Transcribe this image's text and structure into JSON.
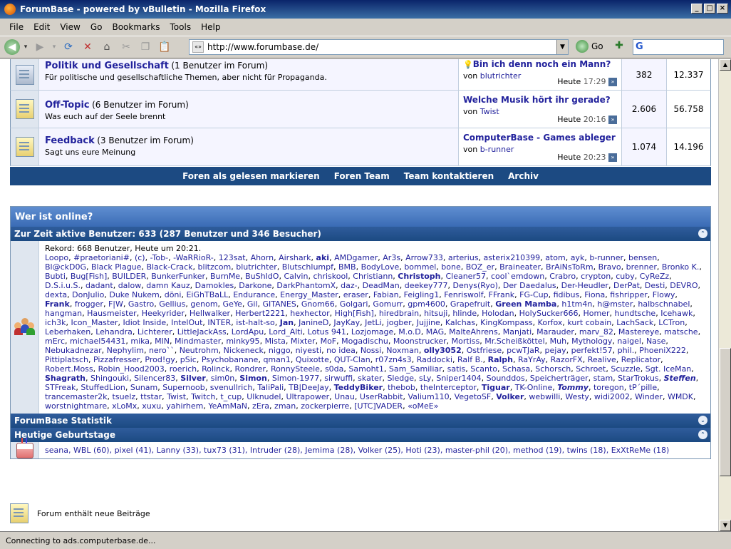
{
  "window": {
    "title": "ForumBase - powered by vBulletin - Mozilla Firefox",
    "minimize_glyph": "_",
    "maximize_glyph": "□",
    "close_glyph": "×"
  },
  "menubar": {
    "items": [
      "File",
      "Edit",
      "View",
      "Go",
      "Bookmarks",
      "Tools",
      "Help"
    ]
  },
  "toolbar": {
    "url": "http://www.forumbase.de/",
    "go_label": "Go",
    "url_icon_glyph": "«»",
    "dropdown_glyph": "▼",
    "search_logo_glyph": "G",
    "icons": [
      {
        "name": "back-icon",
        "glyph": "◀"
      },
      {
        "name": "back-dropdown-icon",
        "glyph": "▾"
      },
      {
        "name": "forward-icon",
        "glyph": "▶"
      },
      {
        "name": "forward-dropdown-icon",
        "glyph": "▾"
      },
      {
        "name": "reload-icon",
        "glyph": "⟳"
      },
      {
        "name": "stop-icon",
        "glyph": "✕"
      },
      {
        "name": "home-icon",
        "glyph": "⌂"
      },
      {
        "name": "cut-icon",
        "glyph": "✂"
      },
      {
        "name": "copy-icon",
        "glyph": "❐"
      },
      {
        "name": "paste-icon",
        "glyph": "📋"
      }
    ],
    "bookmark_glyph": "✚"
  },
  "forums": [
    {
      "name": "Politik und Gesellschaft",
      "count": "(1 Benutzer im Forum)",
      "desc": "Für politische und gesellschaftliche Themen, aber nicht für Propaganda.",
      "last_title": "Bin ich denn noch ein Mann?",
      "by_prefix": "von",
      "last_by": "blutrichter",
      "time_prefix": "Heute",
      "last_time": "17:29",
      "threads": "382",
      "posts": "12.337",
      "icon": "gray"
    },
    {
      "name": "Off-Topic",
      "count": "(6 Benutzer im Forum)",
      "desc": "Was euch auf der Seele brennt",
      "last_title": "Welche Musik hört ihr gerade?",
      "by_prefix": "von",
      "last_by": "Twist",
      "time_prefix": "Heute",
      "last_time": "20:16",
      "threads": "2.606",
      "posts": "56.758",
      "icon": "yellow"
    },
    {
      "name": "Feedback",
      "count": "(3 Benutzer im Forum)",
      "desc": "Sagt uns eure Meinung",
      "last_title": "ComputerBase - Games ableger",
      "by_prefix": "von",
      "last_by": "b-runner",
      "time_prefix": "Heute",
      "last_time": "20:23",
      "threads": "1.074",
      "posts": "14.196",
      "icon": "yellow"
    }
  ],
  "forum_links": [
    "Foren als gelesen markieren",
    "Foren Team",
    "Team kontaktieren",
    "Archiv"
  ],
  "last_post_go_glyph": "»",
  "collapse_glyph": "⌃",
  "expand_glyph": "⌄",
  "who_online": {
    "title": "Wer ist online?",
    "active_header": "Zur Zeit aktive Benutzer: 633 (287 Benutzer und 346 Besucher)",
    "record": "Rekord: 668 Benutzer, Heute um 20:21.",
    "users_text": "Loopo, #praetoriani#, (c), -Tob-, -WaRRioR-, 123sat, Ahorn, Airshark, aki, AMDgamer, Ar3s, Arrow733, arterius, asterix210399, atom, ayk, b-runner, bensen, Bl@ckD0G, Black Plague, Black-Crack, blitzcom, blutrichter, Blutschlumpf, BMB, BodyLove, bommel, bone, BOZ_er, Braineater, BrAiNsToRm, Bravo, brenner, Bronko K., Bubti, Bug[Fish], BUILDER, BunkerFunker, BurnMe, BuShIdO, Calvin, chriskool, Christiann, Christoph, Cleaner57, cool`emdown, Crabro, crypton, cuby, CyReZz, D.S.i.u.S., dadant, dalow, damn Kauz, Damokles, Darkone, DarkPhantomX, daz-, DeadMan, deekey777, Denys(Ryo), Der Daedalus, Der-Heudler, DerPat, Desti, DEVRO, dexta, DonJulio, Duke Nukem, döni, EiGhTBaLL, Endurance, Energy_Master, eraser, Fabian, Feigling1, Fenriswolf, FFrank, FG-Cup, fidibus, Fiona, fishripper, Flowy, Frank, frogger, F|W, Gastro, Gellius, genom, GeYe, Gil, GITANES, Gnom66, Golgari, Gomurr, gpm4600, Grapefruit, Green Mamba, h1tm4n, h@mster, halbschnabel, hangman, Hausmeister, Heekyrider, Hellwalker, Herbert2221, hexhector, High[Fish], hiredbrain, hitsuji, hlinde, Holodan, HolySucker666, Homer, hundtsche, Icehawk, ich3k, Icon_Master, Idiot Inside, IntelOut, INTER, ist-halt-so, Jan, JanineD, JayKay, JetLi, jogber, Jujjine, Kalchas, KingKompass, Korfox, kurt cobain, LachSack, LCTron, Leberhaken, Lehandra, Lichterer, LittleJackAss, LordApu, Lord_Alti, Lotus 941, Lozjomage, M.o.D, MAG, MalteAhrens, Manjati, Marauder, marv_82, Mastereye, matsche, mErc, michael54431, mika, MIN, Mindmaster, minky95, Mista, Mixter, MoF, Mogadischu, Moonstrucker, Mortiss, Mr.Scheißköttel, Muh, Mythology, naigel, Nase, Nebukadnezar, Nephylim, nero``, Neutrohm, Nickeneck, niggo, niyesti, no idea, Nossi, Noxman, olly3052, Ostfriese, pcwTJaR, pejay, perfekt!57, phil., PhoeniX222, Pittiplatsch, Pizzafresser, Prod!gy, pSic, Psychobanane, qman1, Quixotte, QUT-Clan, r07zn4s3, Raddocki, Ralf B., Ralph, RaYrAy, RazorFX, Realive, Replicator, Robert.Moss, Robin_Hood2003, roerich, Rolinck, Rondrer, RonnySteele, s0da, Samoht1, Sam_Samiliar, satis, Scanto, Schasa, Schorsch, Schroet, Scuzzle, Sgt. IceMan, Shagrath, Shingouki, Silencer83, Silver, sim0n, Simon, Simon-1977, sirwuffi, skater, Sledge, sLy, Sniper1404, Sounddos, Speicherträger, stam, StarTrokus, Steffen, STFreak, StuffedLion, Sunam, Supernoob, svenullrich, TaliPali, TB|DeeJay, TeddyBiker, thebob, theInterceptor, Tiguar, TK-Online, Tommy, toregon, tP´pille, trancemaster2k, tsuelz, ttstar, Twist, Twitch, t_cup, Ulknudel, Ultrapower, Unau, UserRabbit, Valium110, VegetoSF, Volker, webwilli, Westy, widi2002, Winder, WMDK, worstnightmare, xLoMx, xuxu, yahirhem, YeAmMaN, zEra, zman, zockerpierre, [UTC]VADER, «oMeE»",
    "bold_users": [
      "aki",
      "Christoph",
      "Frank",
      "Green Mamba",
      "Jan",
      "olly3052",
      "Ralph",
      "Shagrath",
      "Silver",
      "Simon",
      "TeddyBiker",
      "Tiguar",
      "Volker"
    ],
    "bold_italic_users": [
      "Tommy",
      "Steffen"
    ],
    "stats_header": "ForumBase Statistik",
    "birthdays_header": "Heutige Geburtstage",
    "birthdays": "seana, WBL (60), pixel (41), Lanny (33), tux73 (31), Intruder (28), Jemima (28), Volker (25), Hoti (23), master-phil (20), method (19), twins (18), ExXtReMe (18)"
  },
  "legend": {
    "text": "Forum enthält neue Beiträge"
  },
  "status": {
    "text": "Connecting to ads.computerbase.de..."
  },
  "scrollbar": {
    "up_glyph": "▲",
    "down_glyph": "▼"
  }
}
